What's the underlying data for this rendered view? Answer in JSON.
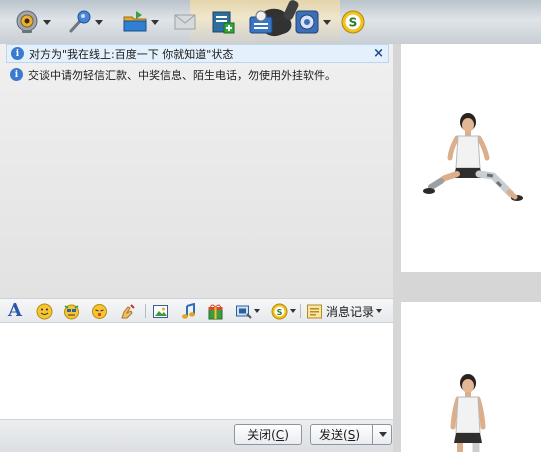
{
  "toolbar": {
    "buttons": [
      {
        "name": "video-call-icon",
        "has_dropdown": true
      },
      {
        "name": "voice-call-icon",
        "has_dropdown": true
      },
      {
        "name": "send-file-icon",
        "has_dropdown": true
      },
      {
        "name": "send-sms-icon",
        "has_dropdown": false
      },
      {
        "name": "create-discussion-icon",
        "has_dropdown": false
      },
      {
        "name": "contact-info-icon",
        "has_dropdown": false
      },
      {
        "name": "app-settings-icon",
        "has_dropdown": true
      },
      {
        "name": "soso-search-icon",
        "has_dropdown": false
      }
    ]
  },
  "chat": {
    "status_notice": "对方为\"我在线上:百度一下 你就知道\"状态",
    "close_symbol": "×",
    "security_warning": "交谈中请勿轻信汇款、中奖信息、陌生电话，勿使用外挂软件。",
    "info_glyph": "i"
  },
  "format_bar": {
    "font_glyph": "A",
    "message_record_label": "消息记录"
  },
  "buttons": {
    "close_label": "关闭(",
    "close_key": "C",
    "close_suffix": ")",
    "send_label": "发送(",
    "send_key": "S",
    "send_suffix": ")"
  },
  "colors": {
    "accent_blue": "#2b57a6",
    "notice_bg": "#e4f0fb",
    "close_blue": "#1b4f8c"
  }
}
